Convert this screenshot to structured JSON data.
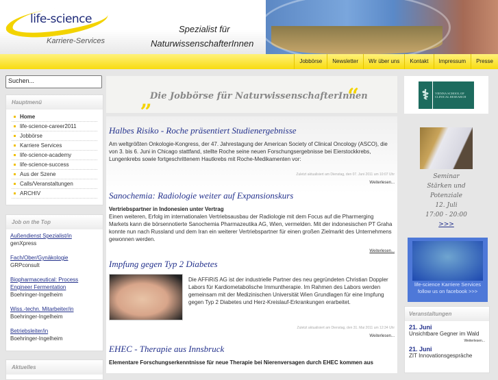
{
  "header": {
    "logo": "life-science",
    "logo_sub": "Karriere-Services",
    "slogan_line1": "Spezialist für",
    "slogan_line2": "NaturwissenschafterInnen"
  },
  "nav": [
    "Jobbörse",
    "Newsletter",
    "Wir über uns",
    "Kontakt",
    "Impressum",
    "Presse"
  ],
  "search": {
    "placeholder": "Suchen..."
  },
  "main_menu": {
    "title": "Hauptmenü",
    "items": [
      "Home",
      "life-science-career2011",
      "Jobbörse",
      "Karriere Services",
      "life-science-academy",
      "life-science-success",
      "Aus der Szene",
      "Calls/Veranstaltungen",
      "ARCHIV"
    ]
  },
  "job_top": {
    "title": "Job on the Top",
    "jobs": [
      {
        "title": "Außendienst Spezialist/in",
        "company": "genXpress"
      },
      {
        "title": "Fach/Ober/Gynäkologie",
        "company": "GRPconsult"
      },
      {
        "title": "Biopharmaceutical: Process Engineer Fermentation",
        "company": "Boehringer-Ingelheim"
      },
      {
        "title": "Wiss.-techn. Mitarbeiter/in",
        "company": "Boehringer-Ingelheim"
      },
      {
        "title": "Betriebsleiter/in",
        "company": "Boehringer-Ingelheim"
      }
    ]
  },
  "aktuelles": {
    "title": "Aktuelles"
  },
  "banner": {
    "text": "Die Jobbörse für NaturwissenschafterInnen",
    "quote_open": "„",
    "quote_close": "“"
  },
  "articles": [
    {
      "title": "Halbes Risiko - Roche präsentiert Studienergebnisse",
      "sub": "",
      "body": "Am weltgrößten Onkologie-Kongress, der 47. Jahrestagung der American Society of Clinical Oncology (ASCO), die von 3. bis 6. Juni in Chicago stattfand, stellte Roche seine neuen Forschungsergebnisse bei Eierstockkrebs, Lungenkrebs sowie fortgeschrittenem Hautkrebs mit  Roche-Medikamenten vor:",
      "meta": "Zuletzt aktualisiert am Dienstag, den 07. Juni 2011 um 10:07 Uhr",
      "more": "Weiterlesen..."
    },
    {
      "title": "Sanochemia: Radiologie weiter auf Expansionskurs",
      "sub": "Vertriebspartner in Indonesien unter Vertrag",
      "body": "Einen weiteren, Erfolg im internationalen Vertriebsausbau der Radiologie mit dem Focus auf die Pharmerging Markets kann die börsennotierte Sanochemia Pharmazeutika AG, Wien, vermelden. Mit der indonesischen PT Graha konnte nun nach Russland und dem Iran ein weiterer Vertriebspartner für einen großen Zielmarkt des Unternehmens gewonnen werden.",
      "meta": "",
      "more": "Weiterlesen..."
    },
    {
      "title": "Impfung gegen Typ 2 Diabetes",
      "sub": "",
      "body": "Die AFFiRiS AG ist der industrielle Partner des neu gegründeten Christian Doppler Labors für Kardiometabolische Immuntherapie. Im Rahmen des Labors werden gemeinsam mit der Medizinischen Universität Wien Grundlagen für eine Impfung gegen Typ 2 Diabetes und Herz-Kreislauf-Erkrankungen erarbeitet.",
      "meta": "Zuletzt aktualisiert am Dienstag, den 31. Mai 2011 um 12:34 Uhr",
      "more": "Weiterlesen..."
    },
    {
      "title": "EHEC - Therapie aus Innsbruck",
      "sub": "Elementare Forschungserkenntnisse für neue Therapie bei Nierenversagen durch EHEC kommen aus"
    }
  ],
  "right": {
    "vscr": "Vienna School of Clinical Research",
    "seminar": [
      "Seminar",
      "Stärken und",
      "Potenziale",
      "12. Juli",
      "17:00 - 20:00"
    ],
    "seminar_link": ">>>",
    "fb_line1": "life-science Karriere Services",
    "fb_line2": "follow us on facebook  >>>"
  },
  "events": {
    "title": "Veranstaltungen",
    "items": [
      {
        "date": "21. Juni",
        "title": "Unsichtbare Gegner im Wald",
        "more": "Weiterlesen..."
      },
      {
        "date": "21. Juni",
        "title": "ZIT Innovationsgespräche"
      }
    ]
  }
}
